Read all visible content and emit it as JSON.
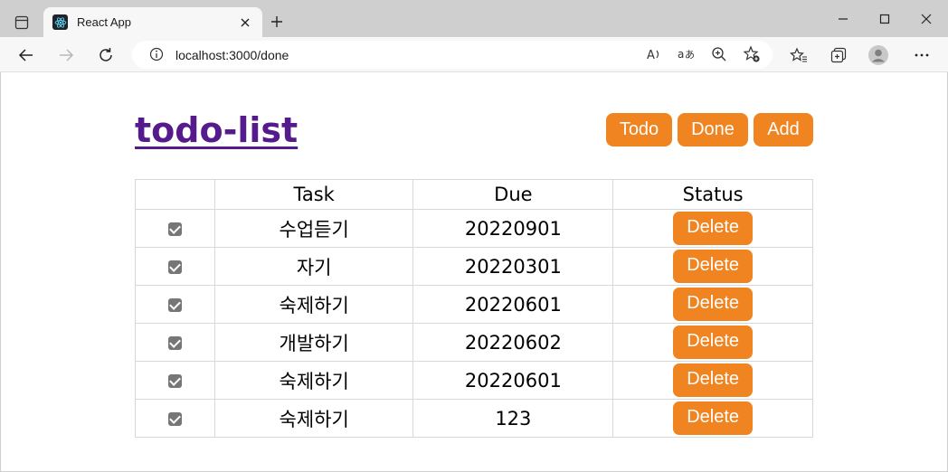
{
  "browser": {
    "tab_title": "React App",
    "url": "localhost:3000/done"
  },
  "app": {
    "title": "todo-list",
    "nav": {
      "todo_label": "Todo",
      "done_label": "Done",
      "add_label": "Add"
    },
    "accent_color": "#ef8421",
    "title_color": "#551a8b"
  },
  "table": {
    "headers": [
      "",
      "Task",
      "Due",
      "Status"
    ],
    "rows": [
      {
        "checked": true,
        "task": "수업듣기",
        "due": "20220901",
        "action": "Delete"
      },
      {
        "checked": true,
        "task": "자기",
        "due": "20220301",
        "action": "Delete"
      },
      {
        "checked": true,
        "task": "숙제하기",
        "due": "20220601",
        "action": "Delete"
      },
      {
        "checked": true,
        "task": "개발하기",
        "due": "20220602",
        "action": "Delete"
      },
      {
        "checked": true,
        "task": "숙제하기",
        "due": "20220601",
        "action": "Delete"
      },
      {
        "checked": true,
        "task": "숙제하기",
        "due": "123",
        "action": "Delete"
      }
    ]
  }
}
